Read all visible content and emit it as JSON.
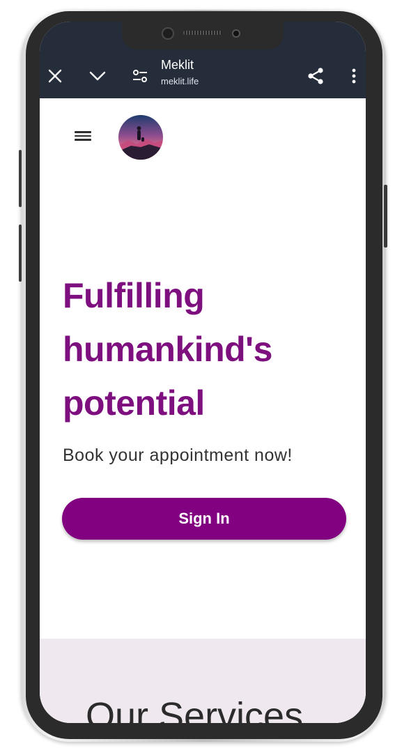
{
  "browser": {
    "title": "Meklit",
    "url": "meklit.life",
    "icons": {
      "close": "close-icon",
      "collapse": "chevron-down-icon",
      "site_settings": "tune-icon",
      "share": "share-icon",
      "more": "more-vert-icon"
    }
  },
  "header": {
    "menu_icon": "hamburger-menu-icon",
    "logo": "avatar-silhouette-sunset"
  },
  "hero": {
    "title_lines": [
      "Fulfilling",
      "humankind's",
      "potential"
    ],
    "subtitle": "Book your appointment now!",
    "button_label": "Sign In"
  },
  "services": {
    "title": "Our Services"
  },
  "colors": {
    "accent": "#820180",
    "title": "#7d0f7f",
    "toolbar": "#252d3a",
    "services_bg": "#efe8ee"
  }
}
